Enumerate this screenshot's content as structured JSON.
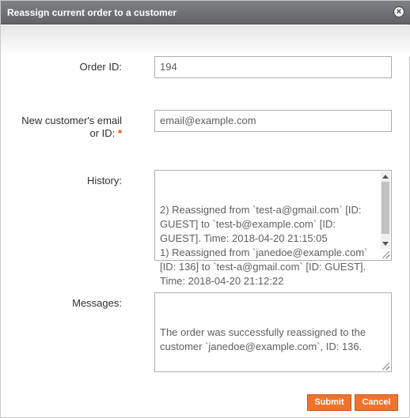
{
  "dialog": {
    "title": "Reassign current order to a customer",
    "close_glyph": "×"
  },
  "form": {
    "order_id_label": "Order ID:",
    "order_id_value": "194",
    "email_label_line1": "New customer's email",
    "email_label_line2": "or ID:",
    "required_mark": "*",
    "email_placeholder": "email@example.com",
    "history_label": "History:",
    "history_text": "2) Reassigned from `test-a@gmail.com` [ID: GUEST] to `test-b@example.com` [ID: GUEST]. Time: 2018-04-20 21:15:05\n1) Reassigned from `janedoe@example.com` [ID: 136] to `test-a@gmail.com` [ID: GUEST]. Time: 2018-04-20 21:12:22",
    "messages_label": "Messages:",
    "messages_text": "The order was successfully reassigned to the customer `janedoe@example.com`, ID: 136."
  },
  "buttons": {
    "submit": "Submit",
    "cancel": "Cancel"
  },
  "colors": {
    "accent": "#f0732d",
    "required": "#eb5202",
    "titlebar": "#6b7073"
  },
  "icons": {
    "close": "close-icon",
    "resize": "resize-grip-icon"
  }
}
